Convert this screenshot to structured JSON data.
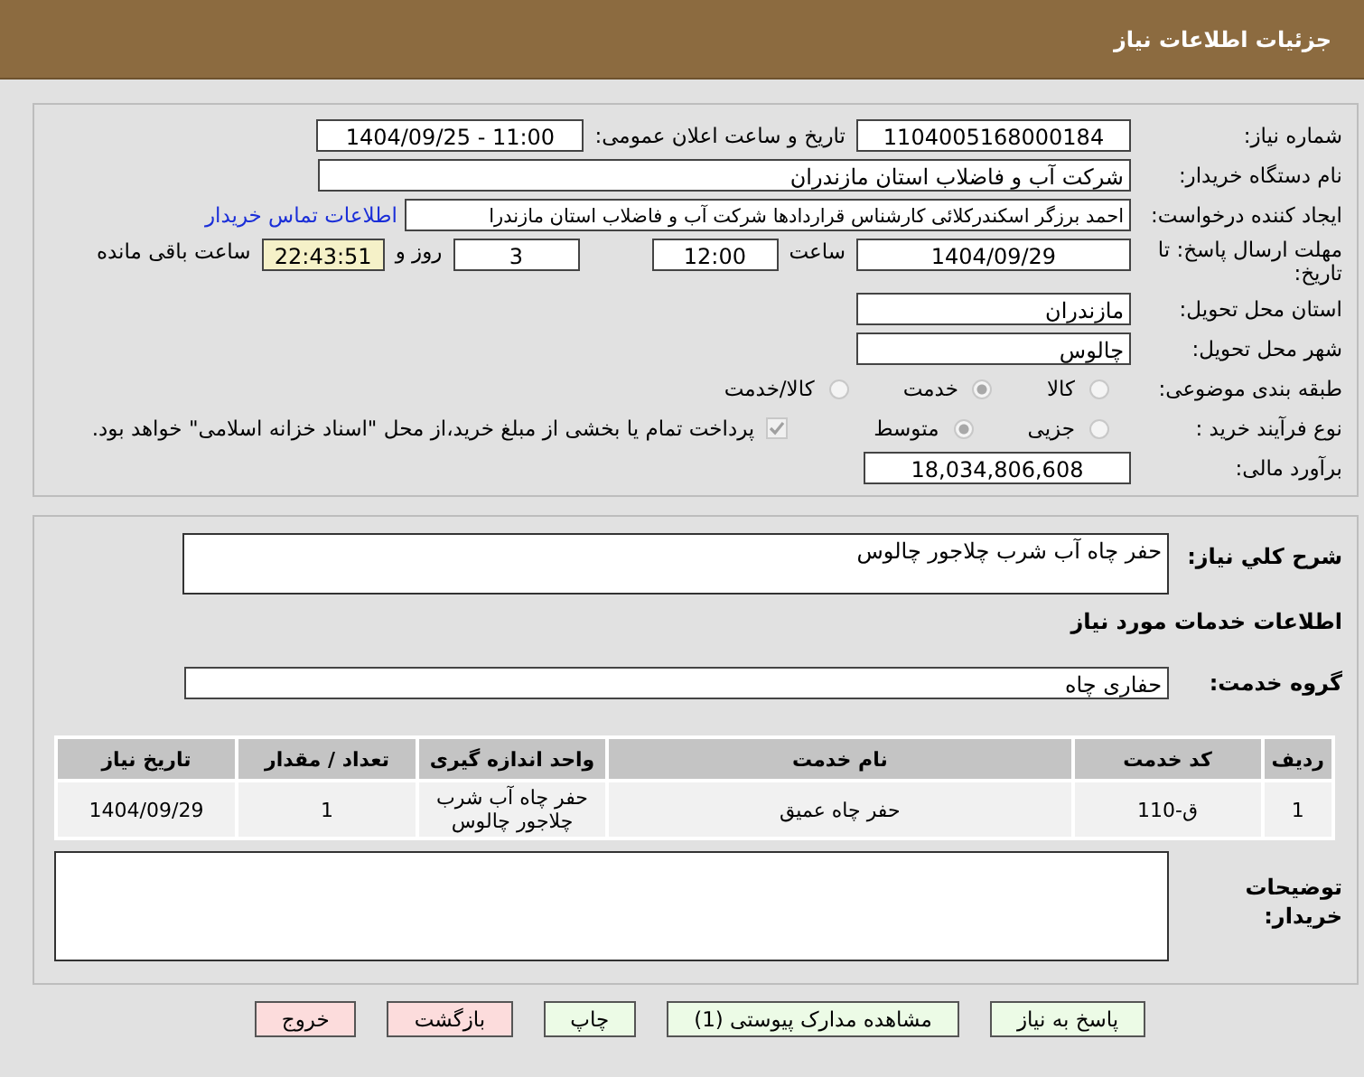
{
  "header": {
    "title": "جزئیات اطلاعات نیاز"
  },
  "need_number": {
    "label": "شماره نیاز:",
    "value": "1104005168000184"
  },
  "announce": {
    "label": "تاریخ و ساعت اعلان عمومی:",
    "value": "1404/09/25 - 11:00"
  },
  "buyer_org": {
    "label": "نام دستگاه خریدار:",
    "value": "شرکت آب و فاضلاب استان مازندران"
  },
  "requester": {
    "label": "ایجاد کننده درخواست:",
    "value": "احمد برزگر اسکندرکلائی کارشناس قراردادها شرکت آب و فاضلاب استان مازندرا",
    "link": "اطلاعات تماس خریدار"
  },
  "deadline": {
    "label": "مهلت ارسال پاسخ: تا تاریخ:",
    "date": "1404/09/29",
    "time_label": "ساعت",
    "time": "12:00",
    "days": "3",
    "days_label": "روز و",
    "remaining": "22:43:51",
    "remaining_label": "ساعت باقی مانده"
  },
  "province": {
    "label": "استان محل تحویل:",
    "value": "مازندران"
  },
  "city": {
    "label": "شهر محل تحویل:",
    "value": "چالوس"
  },
  "category": {
    "label": "طبقه بندی موضوعی:",
    "options": [
      {
        "label": "کالا",
        "selected": false
      },
      {
        "label": "خدمت",
        "selected": true
      },
      {
        "label": "کالا/خدمت",
        "selected": false
      }
    ]
  },
  "purchase_type": {
    "label": "نوع فرآیند خرید :",
    "options": [
      {
        "label": "جزیی",
        "selected": false
      },
      {
        "label": "متوسط",
        "selected": true
      }
    ],
    "payment_note": {
      "checked": true,
      "disabled": true,
      "text": "پرداخت تمام یا بخشی از مبلغ خرید،از محل \"اسناد خزانه اسلامی\" خواهد بود."
    }
  },
  "budget": {
    "label": "برآورد مالی:",
    "value": "18,034,806,608"
  },
  "description": {
    "label": "شرح کلي نياز:",
    "value": "حفر چاه آب شرب چلاجور چالوس"
  },
  "services_heading": "اطلاعات خدمات مورد نیاز",
  "service_group": {
    "label": "گروه خدمت:",
    "value": "حفاری چاه"
  },
  "table": {
    "columns": [
      "ردیف",
      "کد خدمت",
      "نام خدمت",
      "واحد اندازه گیری",
      "تعداد / مقدار",
      "تاریخ نیاز"
    ],
    "rows": [
      [
        "1",
        "ق-110",
        "حفر چاه عمیق",
        "حفر چاه آب شرب چلاجور چالوس",
        "1",
        "1404/09/29"
      ]
    ]
  },
  "buyer_notes": {
    "label": "توضیحات خریدار:"
  },
  "buttons": [
    {
      "label": "پاسخ به نیاز",
      "kind": "normal"
    },
    {
      "label": "مشاهده مدارک پیوستی (1)",
      "kind": "normal"
    },
    {
      "label": "چاپ",
      "kind": "normal"
    },
    {
      "label": "بازگشت",
      "kind": "danger"
    },
    {
      "label": "خروج",
      "kind": "danger"
    }
  ]
}
